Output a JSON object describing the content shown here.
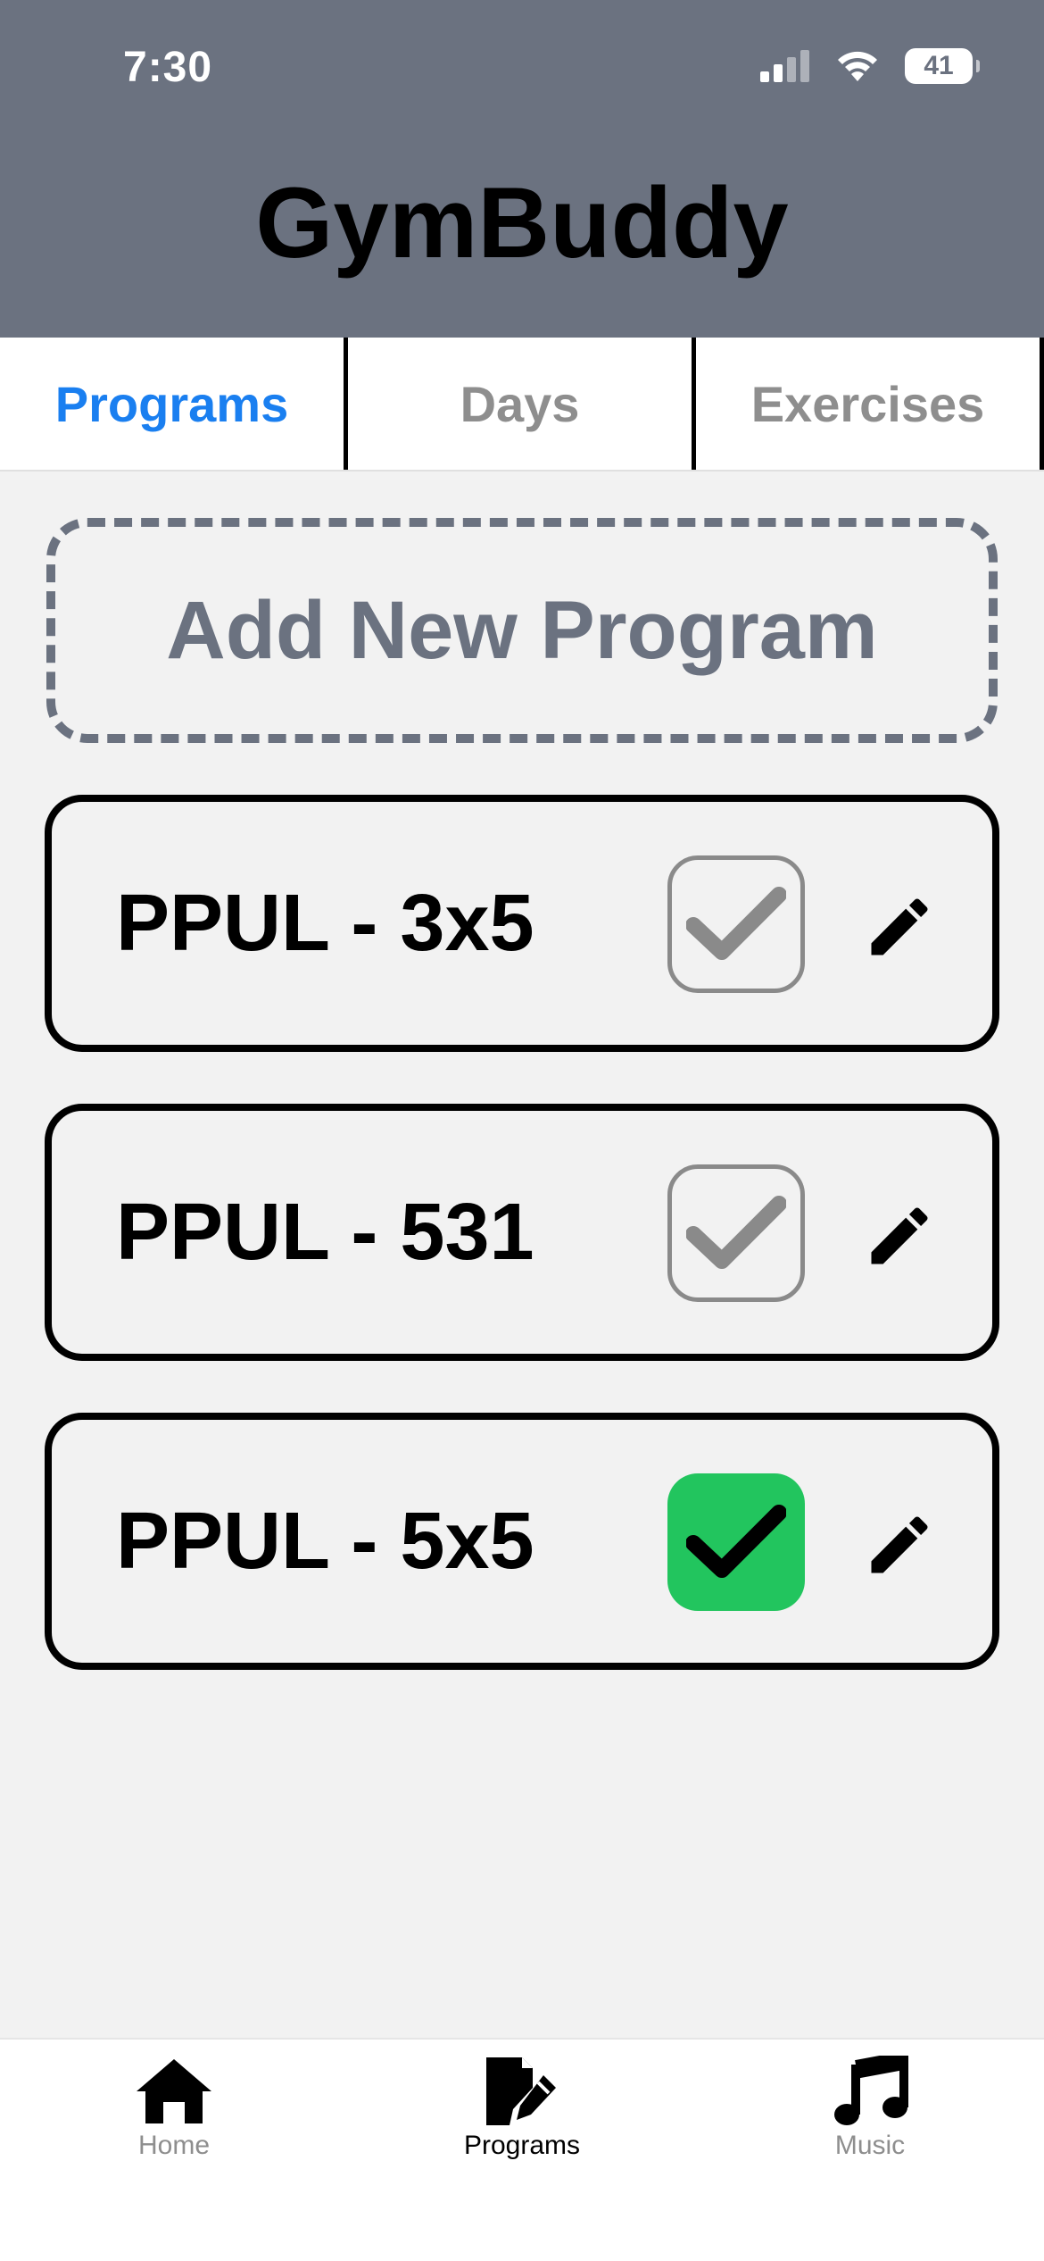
{
  "status_bar": {
    "time": "7:30",
    "battery": "41"
  },
  "app": {
    "title": "GymBuddy"
  },
  "tabs": [
    {
      "label": "Programs",
      "active": true
    },
    {
      "label": "Days",
      "active": false
    },
    {
      "label": "Exercises",
      "active": false
    }
  ],
  "add_program": {
    "label": "Add New Program"
  },
  "programs": [
    {
      "name": "PPUL - 3x5",
      "active": false
    },
    {
      "name": "PPUL - 531",
      "active": false
    },
    {
      "name": "PPUL - 5x5",
      "active": true
    }
  ],
  "bottom_nav": [
    {
      "label": "Home",
      "icon": "home-icon",
      "active": false
    },
    {
      "label": "Programs",
      "icon": "edit-document-icon",
      "active": true
    },
    {
      "label": "Music",
      "icon": "music-note-icon",
      "active": false
    }
  ],
  "colors": {
    "header_bg": "#6b7280",
    "accent_blue": "#1a7ff0",
    "check_green": "#22c55e",
    "page_bg": "#f2f2f2"
  }
}
